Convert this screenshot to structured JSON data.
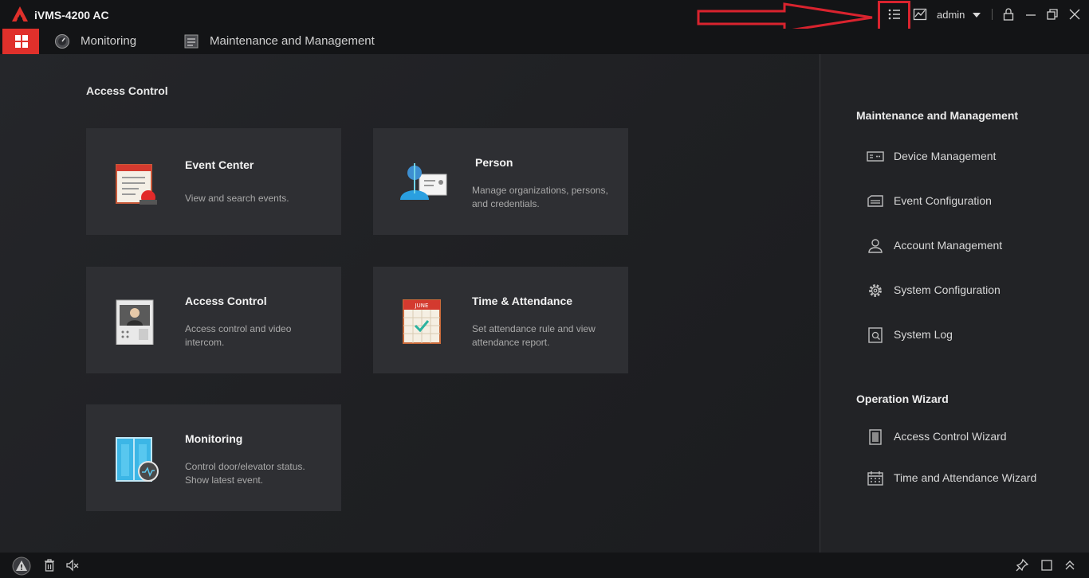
{
  "app": {
    "title": "iVMS-4200 AC",
    "user": "admin",
    "accent": "#e0302b"
  },
  "nav": {
    "tabs": [
      {
        "label": "Monitoring",
        "icon": "monitoring-dial-icon"
      },
      {
        "label": "Maintenance and Management",
        "icon": "maintenance-icon"
      }
    ]
  },
  "main": {
    "section_title": "Access Control",
    "cards": [
      {
        "title": "Event Center",
        "desc": "View and search events.",
        "icon": "event-center-icon"
      },
      {
        "title": "Person",
        "desc": "Manage organizations, persons, and credentials.",
        "icon": "person-icon"
      },
      {
        "title": "Access Control",
        "desc": "Access control and video intercom.",
        "icon": "intercom-icon"
      },
      {
        "title": "Time & Attendance",
        "desc": "Set attendance rule and view attendance report.",
        "icon": "calendar-icon",
        "calendar_month": "JUNE"
      },
      {
        "title": "Monitoring",
        "desc": "Control door/elevator status. Show latest event.",
        "icon": "door-monitor-icon"
      }
    ]
  },
  "right_panel": {
    "maintenance_title": "Maintenance and Management",
    "maintenance_items": [
      {
        "label": "Device Management",
        "icon": "device-icon"
      },
      {
        "label": "Event Configuration",
        "icon": "event-config-icon"
      },
      {
        "label": "Account Management",
        "icon": "account-icon"
      },
      {
        "label": "System Configuration",
        "icon": "gear-icon"
      },
      {
        "label": "System Log",
        "icon": "log-icon"
      }
    ],
    "wizard_title": "Operation Wizard",
    "wizard_items": [
      {
        "label": "Access Control Wizard",
        "icon": "access-wizard-icon"
      },
      {
        "label": "Time and Attendance Wizard",
        "icon": "attendance-wizard-icon"
      }
    ]
  }
}
